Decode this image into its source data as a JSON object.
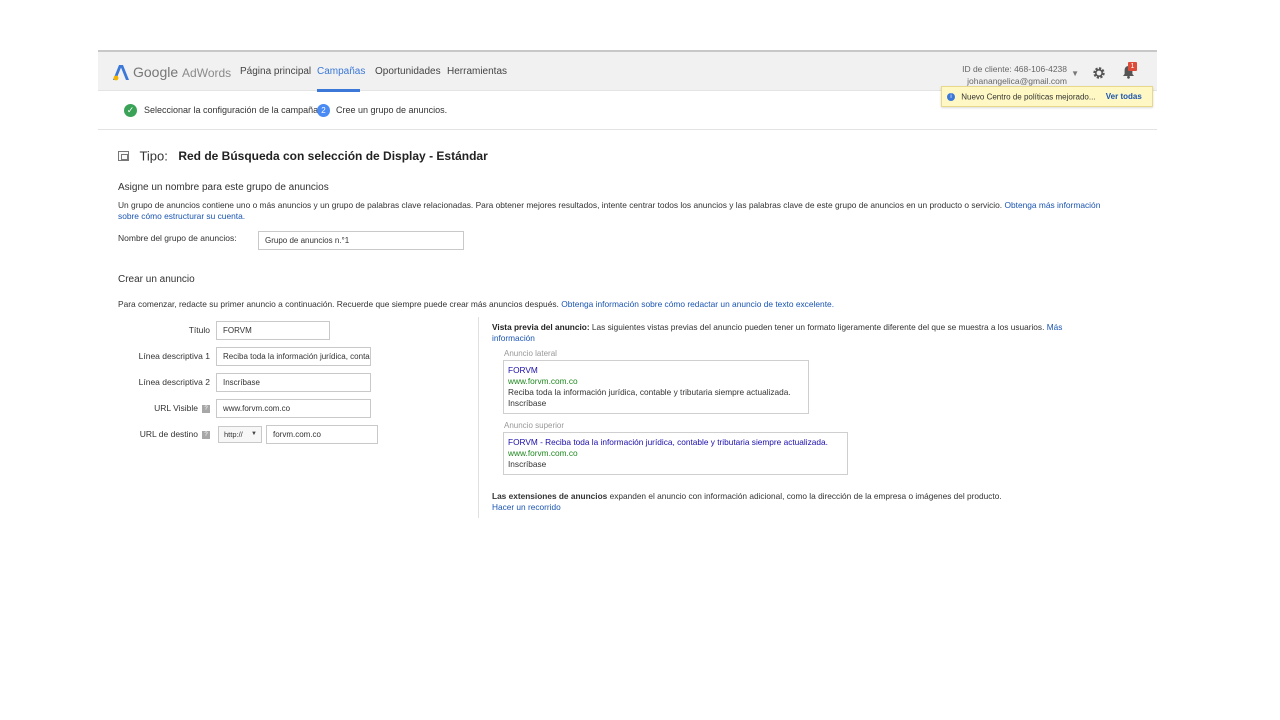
{
  "header": {
    "logo_google": "Google",
    "logo_product": "AdWords",
    "nav": [
      {
        "label": "Página principal",
        "active": false
      },
      {
        "label": "Campañas",
        "active": true
      },
      {
        "label": "Oportunidades",
        "active": false
      },
      {
        "label": "Herramientas",
        "active": false
      }
    ],
    "client_id": "ID de cliente: 468-106-4238",
    "client_email": "johanangelica@gmail.com",
    "notification_count": "1",
    "notification_text": "Nuevo Centro de políticas mejorado...",
    "notification_link": "Ver todas"
  },
  "steps": {
    "step1_label": "Seleccionar la configuración de la campaña",
    "step2_number": "2",
    "step2_label": "Cree un grupo de anuncios."
  },
  "type": {
    "label": "Tipo:",
    "value": "Red de Búsqueda con selección de Display - Estándar"
  },
  "ad_group": {
    "heading": "Asigne un nombre para este grupo de anuncios",
    "description": "Un grupo de anuncios contiene uno o más anuncios y un grupo de palabras clave relacionadas. Para obtener mejores resultados, intente centrar todos los anuncios y las palabras clave de este grupo de anuncios en un producto o servicio.",
    "description_link": "Obtenga más información sobre cómo estructurar su cuenta.",
    "name_label": "Nombre del grupo de anuncios:",
    "name_value": "Grupo de anuncios n.°1"
  },
  "create_ad": {
    "heading": "Crear un anuncio",
    "intro": "Para comenzar, redacte su primer anuncio a continuación. Recuerde que siempre puede crear más anuncios después.",
    "intro_link": "Obtenga información sobre cómo redactar un anuncio de texto excelente.",
    "fields": {
      "title_label": "Título",
      "title_value": "FORVM",
      "line1_label": "Línea descriptiva 1",
      "line1_value": "Reciba toda la información jurídica, contable y tributaria siempre actualizada.",
      "line2_label": "Línea descriptiva 2",
      "line2_value": "Inscríbase",
      "display_url_label": "URL Visible",
      "display_url_value": "www.forvm.com.co",
      "dest_url_label": "URL de destino",
      "protocol_value": "http://",
      "dest_url_value": "forvm.com.co"
    }
  },
  "preview": {
    "title_bold": "Vista previa del anuncio:",
    "title_text": "Las siguientes vistas previas del anuncio pueden tener un formato ligeramente diferente del que se muestra a los usuarios.",
    "title_link": "Más información",
    "side_label": "Anuncio lateral",
    "side": {
      "title": "FORVM",
      "url": "www.forvm.com.co",
      "line1": "Reciba toda la información jurídica, contable y tributaria siempre actualizada.",
      "line2": "Inscríbase"
    },
    "top_label": "Anuncio superior",
    "top": {
      "title": "FORVM - Reciba toda la información jurídica, contable y tributaria siempre actualizada.",
      "url": "www.forvm.com.co",
      "line2": "Inscríbase"
    },
    "extensions_bold": "Las extensiones de anuncios",
    "extensions_text": "expanden el anuncio con información adicional, como la dirección de la empresa o imágenes del producto.",
    "extensions_link": "Hacer un recorrido"
  }
}
